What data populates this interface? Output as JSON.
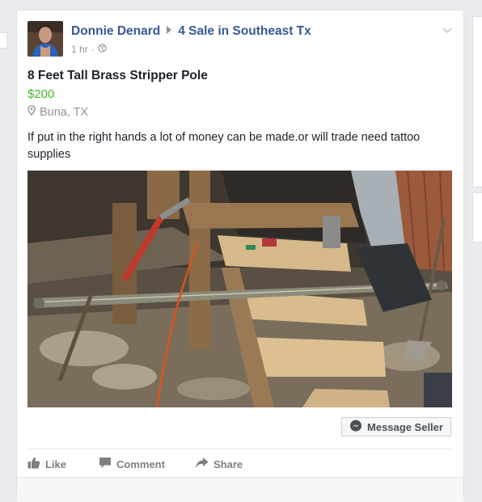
{
  "post": {
    "author": "Donnie Denard",
    "group": "4 Sale in Southeast Tx",
    "time": "1 hr",
    "separator": "·",
    "privacy_icon": "globe-icon",
    "options_icon": "chevron-down-icon"
  },
  "listing": {
    "title": "8 Feet Tall Brass Stripper Pole",
    "price": "$200",
    "location": "Buna, TX",
    "description": "If put in the right hands a lot of money can be made.or will trade need tattoo supplies"
  },
  "buttons": {
    "message_seller": "Message Seller"
  },
  "actions": {
    "like": "Like",
    "comment": "Comment",
    "share": "Share"
  },
  "colors": {
    "link": "#365899",
    "price": "#42b72a",
    "muted": "#90949c"
  }
}
